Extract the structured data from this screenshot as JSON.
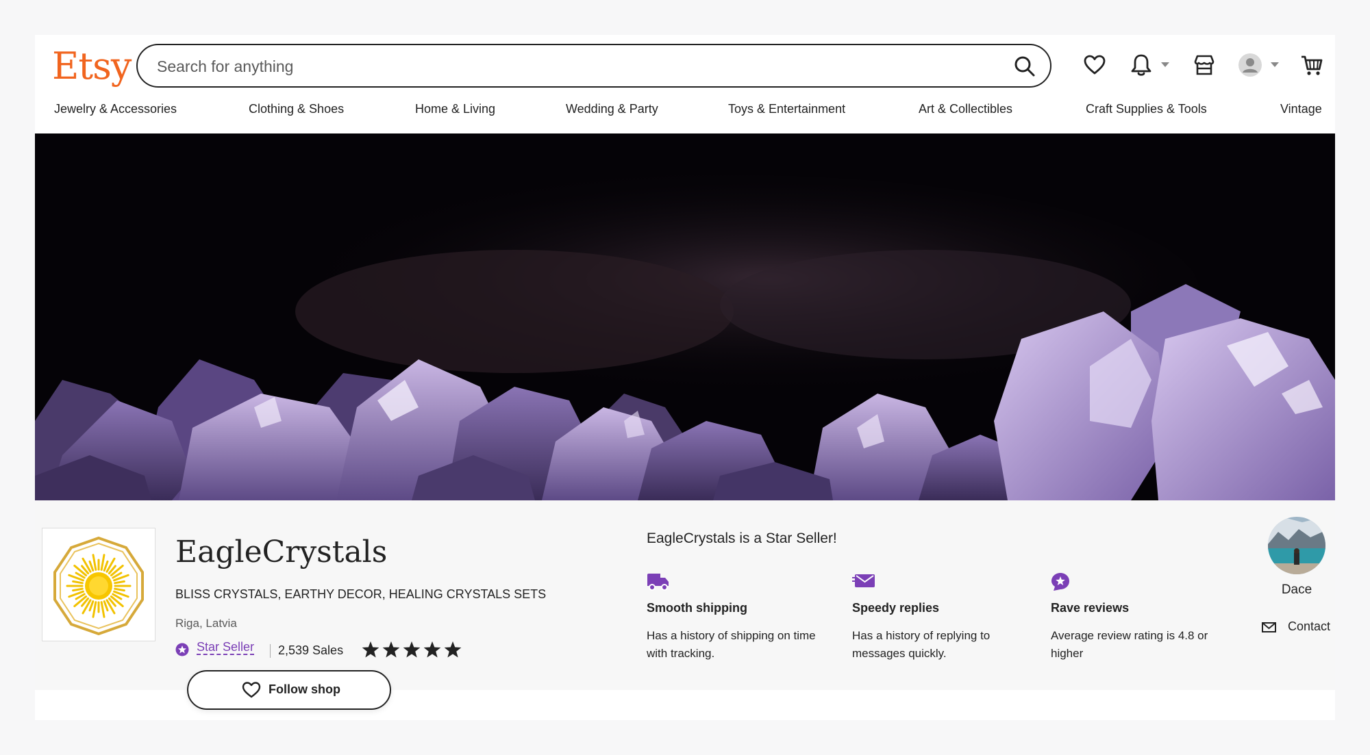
{
  "header": {
    "logo_text": "Etsy",
    "search_placeholder": "Search for anything"
  },
  "icons": {
    "search": "search-icon",
    "favorites": "heart-icon",
    "notifications": "bell-icon",
    "shop_manager": "shop-icon",
    "account": "avatar-icon",
    "cart": "cart-icon"
  },
  "nav": {
    "items": [
      "Jewelry & Accessories",
      "Clothing & Shoes",
      "Home & Living",
      "Wedding & Party",
      "Toys & Entertainment",
      "Art & Collectibles",
      "Craft Supplies & Tools",
      "Vintage"
    ]
  },
  "shop": {
    "name": "EagleCrystals",
    "tagline": "BLISS CRYSTALS, EARTHY DECOR, HEALING CRYSTALS SETS",
    "location": "Riga, Latvia",
    "star_seller_label": "Star Seller",
    "sales": "2,539 Sales",
    "rating_stars": 5,
    "follow_label": "Follow shop"
  },
  "star_seller": {
    "heading": "EagleCrystals is a Star Seller!",
    "perks": [
      {
        "title": "Smooth shipping",
        "description": "Has a history of shipping on time with tracking."
      },
      {
        "title": "Speedy replies",
        "description": "Has a history of replying to messages quickly."
      },
      {
        "title": "Rave reviews",
        "description": "Average review rating is 4.8 or higher"
      }
    ]
  },
  "owner": {
    "name": "Dace",
    "contact_label": "Contact"
  },
  "colors": {
    "brand_orange": "#f1641e",
    "star_seller_purple": "#7b3fb6",
    "text_dark": "#222222"
  }
}
